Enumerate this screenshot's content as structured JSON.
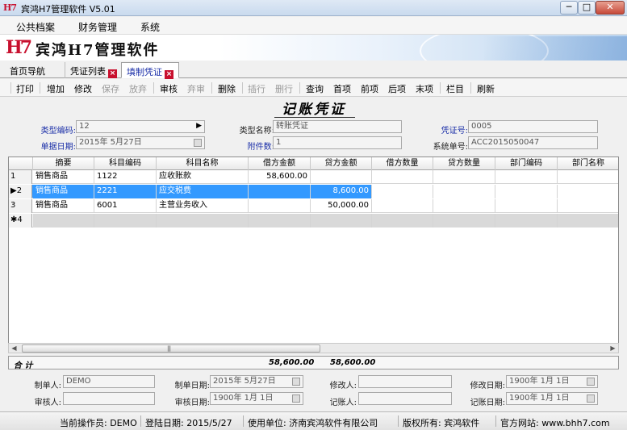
{
  "window": {
    "logo": "H7",
    "title": "宾鸿H7管理软件 V5.01",
    "minimize": "─",
    "maximize": "□",
    "close": "✕"
  },
  "menu": [
    "公共档案",
    "财务管理",
    "系统"
  ],
  "banner": {
    "logo": "H7",
    "name": "宾鸿H7管理软件"
  },
  "tabs": {
    "home": "首页导航",
    "items": [
      {
        "label": "凭证列表",
        "close": "×"
      },
      {
        "label": "填制凭证",
        "close": "×"
      }
    ]
  },
  "toolbar": [
    {
      "label": "打印",
      "enabled": true
    },
    {
      "label": "增加",
      "enabled": true
    },
    {
      "label": "修改",
      "enabled": true
    },
    {
      "label": "保存",
      "enabled": false
    },
    {
      "label": "放弃",
      "enabled": false
    },
    {
      "label": "审核",
      "enabled": true
    },
    {
      "label": "弃审",
      "enabled": false
    },
    {
      "label": "删除",
      "enabled": true
    },
    {
      "label": "插行",
      "enabled": false
    },
    {
      "label": "删行",
      "enabled": false
    },
    {
      "label": "查询",
      "enabled": true
    },
    {
      "label": "首项",
      "enabled": true
    },
    {
      "label": "前项",
      "enabled": true
    },
    {
      "label": "后项",
      "enabled": true
    },
    {
      "label": "末项",
      "enabled": true
    },
    {
      "label": "栏目",
      "enabled": true
    },
    {
      "label": "刷新",
      "enabled": true
    }
  ],
  "form": {
    "title": "记账凭证",
    "type_code_label": "类型编码:",
    "type_code_value": "12",
    "type_code_arrow": "▶",
    "type_name_label": "类型名称:",
    "type_name_value": "转账凭证",
    "voucher_no_label": "凭证号:",
    "voucher_no_value": "0005",
    "date_label": "单据日期:",
    "date_value": "2015年 5月27日",
    "attach_label": "附件数:",
    "attach_value": "1",
    "sys_no_label": "系统单号:",
    "sys_no_value": "ACC2015050047"
  },
  "grid": {
    "columns": [
      "摘要",
      "科目编码",
      "科目名称",
      "借方金额",
      "贷方金额",
      "借方数量",
      "贷方数量",
      "部门编码",
      "部门名称"
    ],
    "rows": [
      {
        "index": "1",
        "marker": "",
        "summary": "销售商品",
        "code": "1122",
        "name": "应收账款",
        "debit": "58,600.00",
        "credit": ""
      },
      {
        "index": "2",
        "marker": "▶",
        "summary": "销售商品",
        "code": "2221",
        "name": "应交税费",
        "debit": "",
        "credit": "8,600.00"
      },
      {
        "index": "3",
        "marker": "",
        "summary": "销售商品",
        "code": "6001",
        "name": "主营业务收入",
        "debit": "",
        "credit": "50,000.00"
      }
    ],
    "new_row_marker": "✱",
    "new_row_index": "4"
  },
  "scroll": {
    "left": "◀",
    "right": "▶",
    "grip": "|||"
  },
  "totals": {
    "label": "合 计",
    "debit": "58,600.00",
    "credit": "58,600.00"
  },
  "footer": {
    "maker_label": "制单人:",
    "maker_value": "DEMO",
    "make_date_label": "制单日期:",
    "make_date_value": "2015年 5月27日",
    "modifier_label": "修改人:",
    "modifier_value": "",
    "modify_date_label": "修改日期:",
    "modify_date_value": "1900年 1月 1日",
    "auditor_label": "审核人:",
    "auditor_value": "",
    "audit_date_label": "审核日期:",
    "audit_date_value": "1900年 1月 1日",
    "poster_label": "记账人:",
    "poster_value": "",
    "post_date_label": "记账日期:",
    "post_date_value": "1900年 1月 1日"
  },
  "status": {
    "operator": "当前操作员: DEMO",
    "login_date": "登陆日期: 2015/5/27",
    "company": "使用单位: 济南宾鸿软件有限公司",
    "copyright": "版权所有: 宾鸿软件",
    "website": "官方网站: www.bhh7.com"
  },
  "colors": {
    "accent": "#1b2fa8",
    "logo": "#c8102e",
    "selection": "#3399ff"
  }
}
